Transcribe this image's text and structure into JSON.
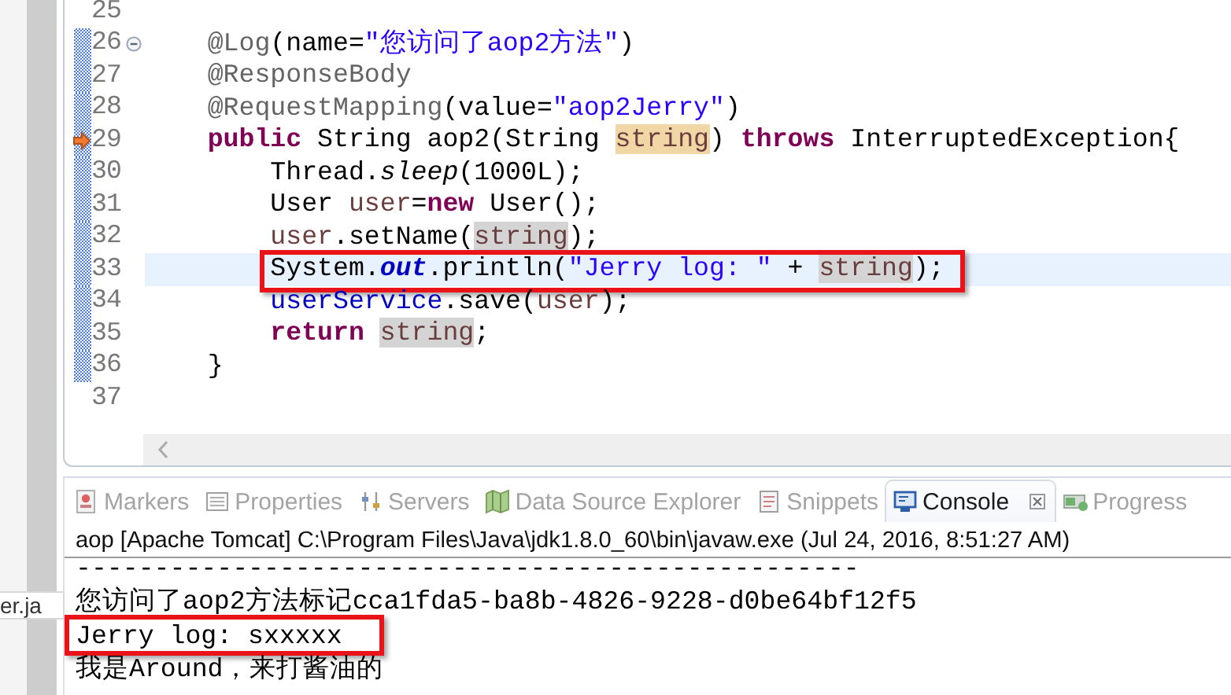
{
  "side_label": "er.ja",
  "editor": {
    "lines": [
      {
        "number": "25",
        "changed": false
      },
      {
        "number": "26",
        "changed": true,
        "foldable": true,
        "tokens": [
          {
            "text": "    @Log",
            "kind": "annotation"
          },
          {
            "text": "(name=",
            "kind": "plain"
          },
          {
            "text": "\"您访问了aop2方法\"",
            "kind": "string"
          },
          {
            "text": ")",
            "kind": "plain"
          }
        ]
      },
      {
        "number": "27",
        "changed": true,
        "tokens": [
          {
            "text": "    @ResponseBody",
            "kind": "annotation"
          }
        ]
      },
      {
        "number": "28",
        "changed": true,
        "tokens": [
          {
            "text": "    @RequestMapping",
            "kind": "annotation"
          },
          {
            "text": "(value=",
            "kind": "plain"
          },
          {
            "text": "\"aop2Jerry\"",
            "kind": "string"
          },
          {
            "text": ")",
            "kind": "plain"
          }
        ]
      },
      {
        "number": "29",
        "changed": true,
        "current_instruction": true,
        "tokens": [
          {
            "text": "    public",
            "kind": "keyword"
          },
          {
            "text": " String aop2(String ",
            "kind": "plain"
          },
          {
            "text": "string",
            "kind": "local",
            "declaration": true
          },
          {
            "text": ") ",
            "kind": "plain"
          },
          {
            "text": "throws",
            "kind": "keyword"
          },
          {
            "text": " InterruptedException{",
            "kind": "plain"
          }
        ]
      },
      {
        "number": "30",
        "changed": true,
        "tokens": [
          {
            "text": "        Thread.",
            "kind": "plain"
          },
          {
            "text": "sleep",
            "kind": "static-method"
          },
          {
            "text": "(1000L);",
            "kind": "plain"
          }
        ]
      },
      {
        "number": "31",
        "changed": true,
        "tokens": [
          {
            "text": "        User ",
            "kind": "plain"
          },
          {
            "text": "user",
            "kind": "local"
          },
          {
            "text": "=",
            "kind": "plain"
          },
          {
            "text": "new",
            "kind": "keyword"
          },
          {
            "text": " User();",
            "kind": "plain"
          }
        ]
      },
      {
        "number": "32",
        "changed": true,
        "tokens": [
          {
            "text": "        user",
            "kind": "local"
          },
          {
            "text": ".setName(",
            "kind": "plain"
          },
          {
            "text": "string",
            "kind": "local",
            "occurrence": true
          },
          {
            "text": ");",
            "kind": "plain"
          }
        ]
      },
      {
        "number": "33",
        "changed": true,
        "current": true,
        "framed": true,
        "tokens": [
          {
            "text": "        System.",
            "kind": "plain"
          },
          {
            "text": "out",
            "kind": "static-field"
          },
          {
            "text": ".println(",
            "kind": "plain"
          },
          {
            "text": "\"Jerry log: \"",
            "kind": "string"
          },
          {
            "text": " + ",
            "kind": "plain"
          },
          {
            "text": "string",
            "kind": "local",
            "occurrence": true
          },
          {
            "text": ");",
            "kind": "plain"
          }
        ]
      },
      {
        "number": "34",
        "changed": true,
        "tokens": [
          {
            "text": "        userService",
            "kind": "field"
          },
          {
            "text": ".save(",
            "kind": "plain"
          },
          {
            "text": "user",
            "kind": "local"
          },
          {
            "text": ");",
            "kind": "plain"
          }
        ]
      },
      {
        "number": "35",
        "changed": true,
        "tokens": [
          {
            "text": "        return ",
            "kind": "keyword"
          },
          {
            "text": "string",
            "kind": "local",
            "occurrence": true
          },
          {
            "text": ";",
            "kind": "plain"
          }
        ]
      },
      {
        "number": "36",
        "changed": true,
        "tokens": [
          {
            "text": "    }",
            "kind": "plain"
          }
        ]
      },
      {
        "number": "37",
        "changed": false
      }
    ]
  },
  "panel": {
    "tabs": [
      {
        "label": "Markers",
        "selected": false
      },
      {
        "label": "Properties",
        "selected": false
      },
      {
        "label": "Servers",
        "selected": false
      },
      {
        "label": "Data Source Explorer",
        "selected": false
      },
      {
        "label": "Snippets",
        "selected": false
      },
      {
        "label": "Console",
        "selected": true
      },
      {
        "label": "Progress",
        "selected": false
      }
    ],
    "console_title": "aop [Apache Tomcat] C:\\Program Files\\Java\\jdk1.8.0_60\\bin\\javaw.exe (Jul 24, 2016, 8:51:27 AM)",
    "console_lines": [
      {
        "text": "--------------------------------------------------",
        "framed": false
      },
      {
        "text": "您访问了aop2方法标记cca1fda5-ba8b-4826-9228-d0be64bf12f5",
        "framed": false
      },
      {
        "text": "Jerry log: sxxxxx",
        "framed": true
      },
      {
        "text": "我是Around，来打酱油的",
        "framed": false
      }
    ]
  }
}
